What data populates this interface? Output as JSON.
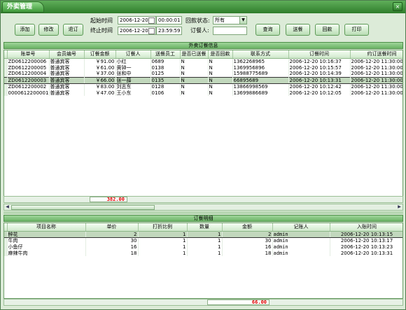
{
  "window": {
    "title": "外卖管理",
    "close_glyph": "×"
  },
  "toolbar": {
    "add": "添加",
    "edit": "修改",
    "cancel": "退订",
    "query": "查询",
    "deliver": "送餐",
    "collect": "回款",
    "print": "打印"
  },
  "filter": {
    "start_label": "起始时间",
    "start_date": "2006-12-20",
    "start_time": "00:00:01",
    "end_label": "终止时间",
    "end_date": "2006-12-20",
    "end_time": "23:59:59",
    "status_label": "回款状态:",
    "status_value": "所有",
    "orderer_label": "订餐人:",
    "orderer_value": ""
  },
  "orders": {
    "section_title": "外卖订餐信息",
    "columns": [
      "账单号",
      "会员编号",
      "订餐金额",
      "订餐人",
      "送餐员工",
      "是否已送餐",
      "是否回款",
      "联系方式",
      "订餐时间",
      "约订送餐时间"
    ],
    "rows": [
      [
        "ZD0612200006",
        "普通宾客",
        "￥91.00",
        "小红",
        "0689",
        "N",
        "N",
        "1362268965",
        "2006-12-20 10:16:37",
        "2006-12-20 11:30:00"
      ],
      [
        "ZD0612200005",
        "普通宾客",
        "￥61.00",
        "黄钟一",
        "0138",
        "N",
        "N",
        "1369956896",
        "2006-12-20 10:15:57",
        "2006-12-20 11:30:00"
      ],
      [
        "ZD0612200004",
        "普通宾客",
        "￥37.00",
        "张和中",
        "0125",
        "N",
        "N",
        "15988775689",
        "2006-12-20 10:14:39",
        "2006-12-20 11:30:00"
      ],
      [
        "ZD0612200003",
        "普通宾客",
        "￥66.00",
        "张一薛",
        "0135",
        "N",
        "N",
        "66895689",
        "2006-12-20 10:13:31",
        "2006-12-20 11:30:00"
      ],
      [
        "ZD0612200002",
        "普通宾客",
        "￥83.00",
        "刘志东",
        "0128",
        "N",
        "N",
        "13866998569",
        "2006-12-20 10:12:42",
        "2006-12-20 11:30:00"
      ],
      [
        "0000612200001",
        "普通宾客",
        "￥47.00",
        "王小东",
        "0106",
        "N",
        "N",
        "13699886689",
        "2006-12-20 10:12:05",
        "2006-12-20 11:30:00"
      ]
    ],
    "selected_index": 3,
    "total": "382.00"
  },
  "details": {
    "section_title": "订餐明细",
    "columns": [
      "项目名称",
      "单价",
      "打折比例",
      "数量",
      "金额",
      "记账人",
      "入账时间"
    ],
    "rows": [
      [
        "醉花",
        "2",
        "1",
        "1",
        "2",
        "admin",
        "2006-12-20 10:13:15"
      ],
      [
        "牛肉",
        "30",
        "1",
        "1",
        "30",
        "admin",
        "2006-12-20 10:13:17"
      ],
      [
        "小鱼仔",
        "16",
        "1",
        "1",
        "16",
        "admin",
        "2006-12-20 10:13:23"
      ],
      [
        "麻辣牛肉",
        "18",
        "1",
        "1",
        "18",
        "admin",
        "2006-12-20 10:13:31"
      ]
    ],
    "selected_index": 0,
    "total": "66.00"
  },
  "icons": {
    "close": "close-icon",
    "calendar": "calendar-icon",
    "dropdown": "chevron-down-icon"
  }
}
